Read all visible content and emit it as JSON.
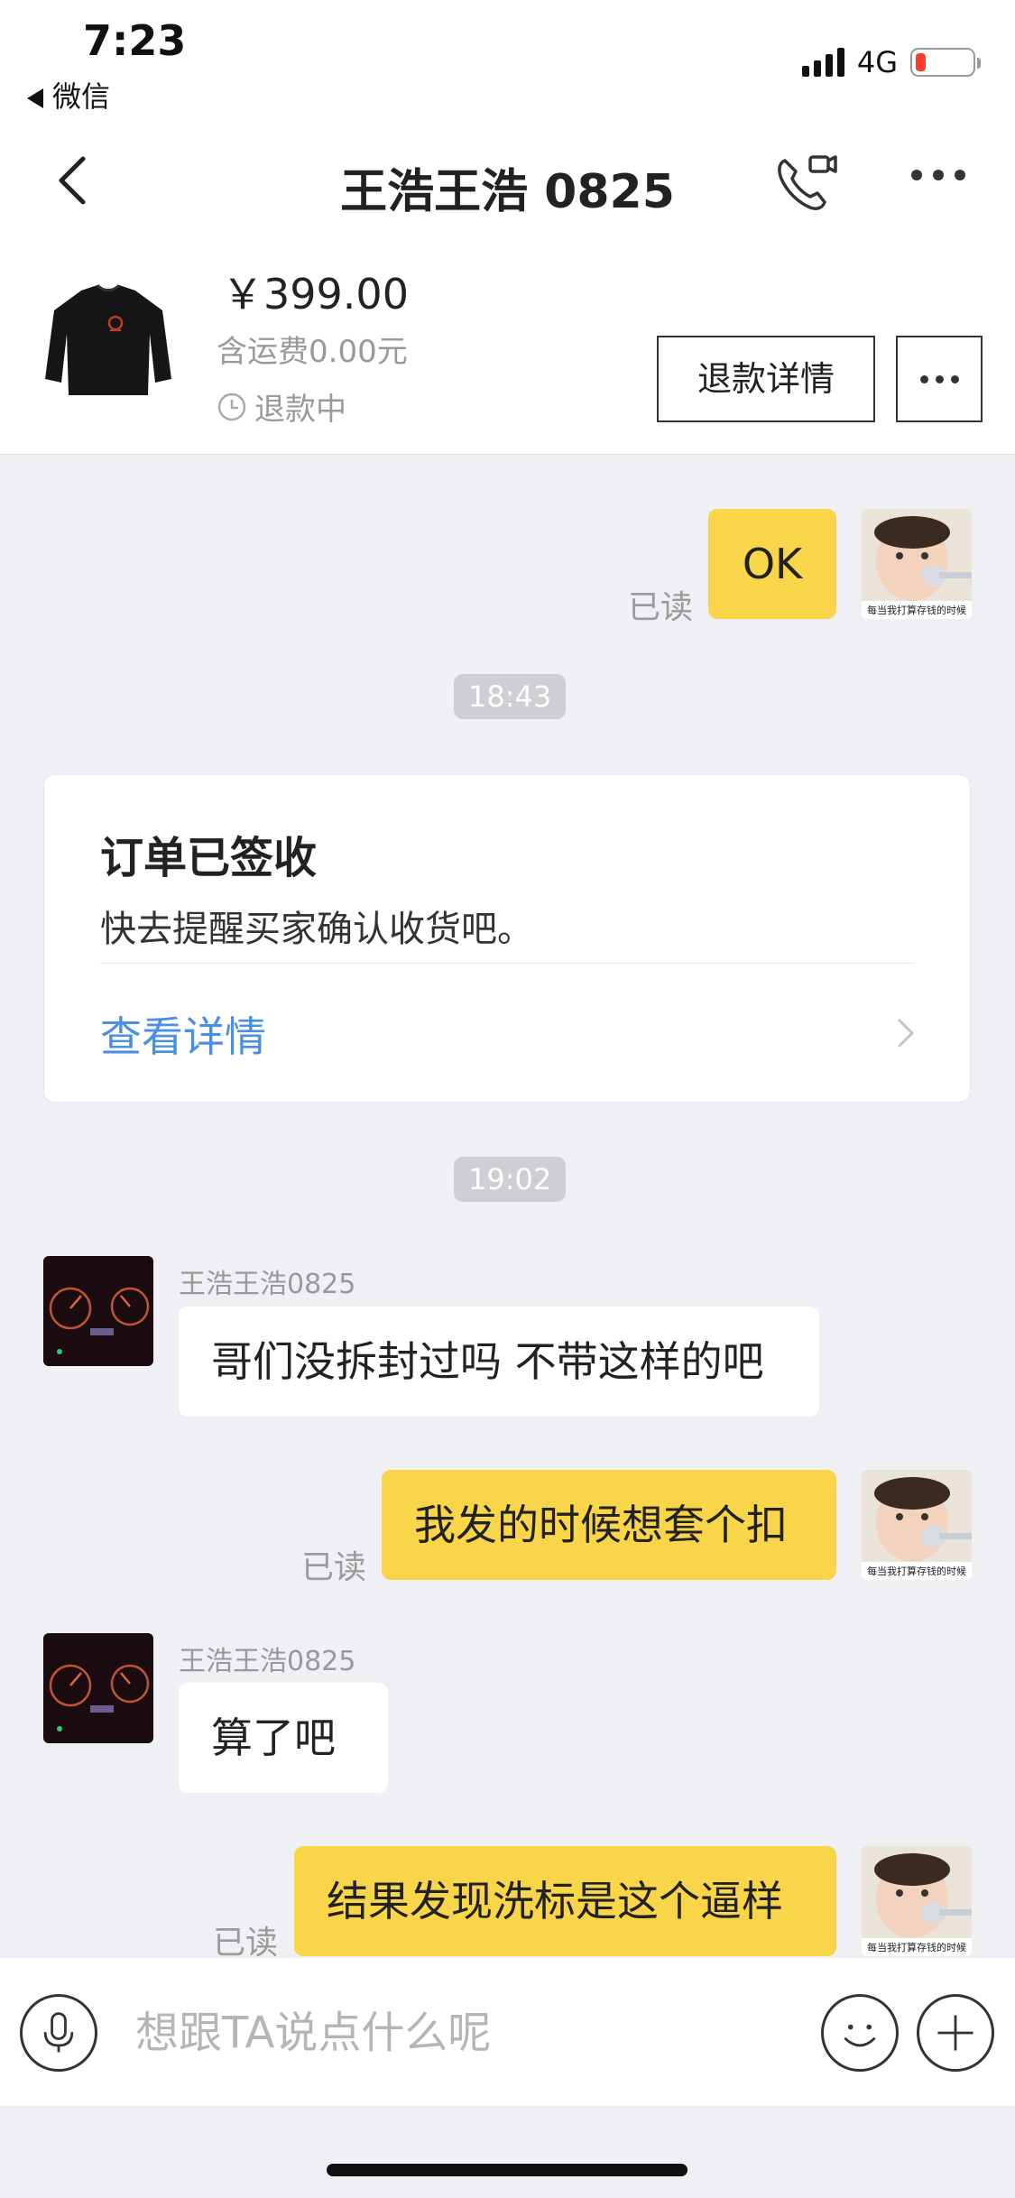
{
  "status_bar": {
    "time": "7:23",
    "back_app": "微信",
    "network": "4G",
    "battery_level": 0.18
  },
  "nav": {
    "title": "王浩王浩 0825"
  },
  "product": {
    "price": "￥399.00",
    "shipping": "含运费0.00元",
    "status": "退款中",
    "refund_button": "退款详情"
  },
  "messages": {
    "m1": {
      "text": "OK",
      "read": "已读"
    },
    "time1": "18:43",
    "order_card": {
      "title": "订单已签收",
      "desc": "快去提醒买家确认收货吧。",
      "link": "查看详情"
    },
    "time2": "19:02",
    "m2": {
      "sender": "王浩王浩0825",
      "text": "哥们没拆封过吗 不带这样的吧"
    },
    "m3": {
      "text": "我发的时候想套个扣",
      "read": "已读"
    },
    "m4": {
      "sender": "王浩王浩0825",
      "text": "算了吧"
    },
    "m5": {
      "text": "结果发现洗标是这个逼样",
      "read": "已读"
    },
    "my_avatar_caption": "每当我打算存钱的时候"
  },
  "input": {
    "placeholder": "想跟TA说点什么呢"
  },
  "colors": {
    "accent_yellow": "#f9d54a",
    "link_blue": "#4a90e2",
    "battery_red": "#ff3b30"
  }
}
